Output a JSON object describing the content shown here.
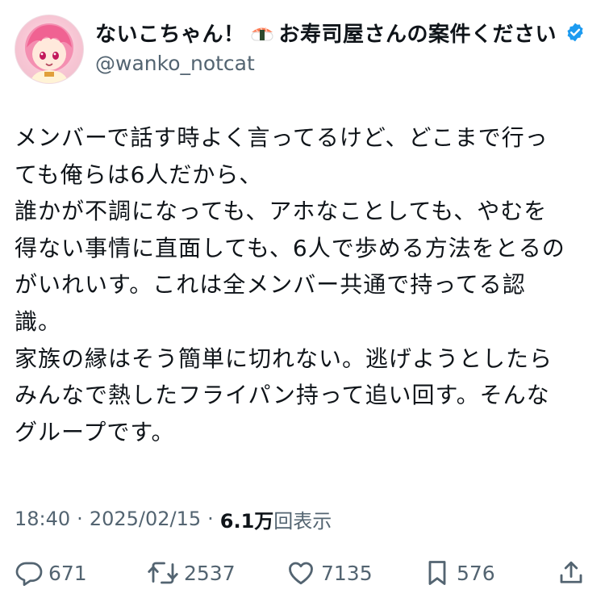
{
  "author": {
    "display_name": "ないこちゃん！",
    "display_name_suffix": "お寿司屋さんの案件ください",
    "handle": "@wanko_notcat",
    "verified": true,
    "avatar_icon": "anime-avatar-pink-hair",
    "accent_color": "#1d9bf0"
  },
  "tweet": {
    "lines": [
      "メンバーで話す時よく言ってるけど、どこまで行っ",
      "ても俺らは6人だから、",
      "誰かが不調になっても、アホなことしても、やむを",
      "得ない事情に直面しても、6人で歩める方法をとるの",
      "がいれいす。これは全メンバー共通で持ってる認",
      "識。",
      "家族の縁はそう簡単に切れない。逃げようとしたら",
      "みんなで熱したフライパン持って追い回す。そんな",
      "グループです。"
    ]
  },
  "meta": {
    "time": "18:40",
    "separator": "·",
    "date": "2025/02/15",
    "views_count": "6.1万",
    "views_label": "回表示"
  },
  "actions": {
    "reply_count": "671",
    "retweet_count": "2537",
    "like_count": "7135",
    "bookmark_count": "576"
  }
}
